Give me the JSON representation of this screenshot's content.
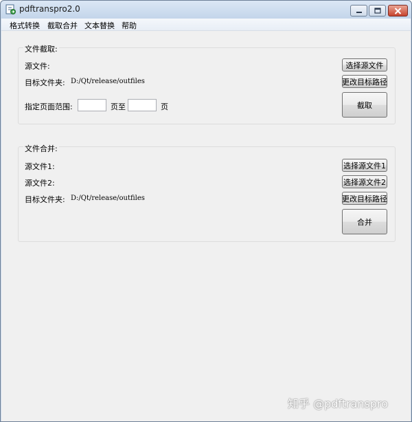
{
  "window": {
    "title": "pdftranspro2.0",
    "controls": [
      "minimize",
      "maximize",
      "close"
    ]
  },
  "menu": [
    "格式转换",
    "截取合并",
    "文本替换",
    "帮助"
  ],
  "extract_group": {
    "title": "文件截取:",
    "source_label": "源文件:",
    "target_label": "目标文件夹:",
    "target_path": "D:/Qt/release/outfiles",
    "range_label": "指定页面范围:",
    "from_value": "",
    "to_label": "页至",
    "to_value": "",
    "page_label": "页",
    "choose_source_button": "选择源文件",
    "change_target_button": "更改目标路径",
    "extract_button": "截取"
  },
  "merge_group": {
    "title": "文件合并:",
    "source1_label": "源文件1:",
    "source2_label": "源文件2:",
    "target_label": "目标文件夹:",
    "target_path": "D:/Qt/release/outfiles",
    "choose_source1_button": "选择源文件1",
    "choose_source2_button": "选择源文件2",
    "change_target_button": "更改目标路径",
    "merge_button": "合并"
  },
  "watermark": "知乎 @pdftranspro"
}
